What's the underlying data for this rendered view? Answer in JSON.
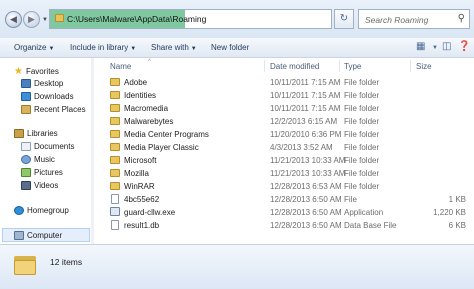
{
  "address": {
    "path": "C:\\Users\\Malware\\AppData\\Roaming",
    "search_placeholder": "Search Roaming"
  },
  "toolbar": {
    "organize": "Organize",
    "include_in_library": "Include in library",
    "share_with": "Share with",
    "new_folder": "New folder"
  },
  "nav": {
    "favorites": "Favorites",
    "desktop": "Desktop",
    "downloads": "Downloads",
    "recent_places": "Recent Places",
    "libraries": "Libraries",
    "documents": "Documents",
    "music": "Music",
    "pictures": "Pictures",
    "videos": "Videos",
    "homegroup": "Homegroup",
    "computer": "Computer"
  },
  "columns": {
    "name": "Name",
    "date_modified": "Date modified",
    "type": "Type",
    "size": "Size"
  },
  "files": [
    {
      "name": "Adobe",
      "date": "10/11/2011 7:15 AM",
      "type": "File folder",
      "size": ""
    },
    {
      "name": "Identities",
      "date": "10/11/2011 7:15 AM",
      "type": "File folder",
      "size": ""
    },
    {
      "name": "Macromedia",
      "date": "10/11/2011 7:15 AM",
      "type": "File folder",
      "size": ""
    },
    {
      "name": "Malwarebytes",
      "date": "12/2/2013 6:15 AM",
      "type": "File folder",
      "size": ""
    },
    {
      "name": "Media Center Programs",
      "date": "11/20/2010 6:36 PM",
      "type": "File folder",
      "size": ""
    },
    {
      "name": "Media Player Classic",
      "date": "4/3/2013 3:52 AM",
      "type": "File folder",
      "size": ""
    },
    {
      "name": "Microsoft",
      "date": "11/21/2013 10:33 AM",
      "type": "File folder",
      "size": ""
    },
    {
      "name": "Mozilla",
      "date": "11/21/2013 10:33 AM",
      "type": "File folder",
      "size": ""
    },
    {
      "name": "WinRAR",
      "date": "12/28/2013 6:53 AM",
      "type": "File folder",
      "size": ""
    },
    {
      "name": "4bc55e62",
      "date": "12/28/2013 6:50 AM",
      "type": "File",
      "size": "1 KB"
    },
    {
      "name": "guard-cllw.exe",
      "date": "12/28/2013 6:50 AM",
      "type": "Application",
      "size": "1,220 KB"
    },
    {
      "name": "result1.db",
      "date": "12/28/2013 6:50 AM",
      "type": "Data Base File",
      "size": "6 KB"
    }
  ],
  "status": {
    "item_count": "12 items"
  }
}
